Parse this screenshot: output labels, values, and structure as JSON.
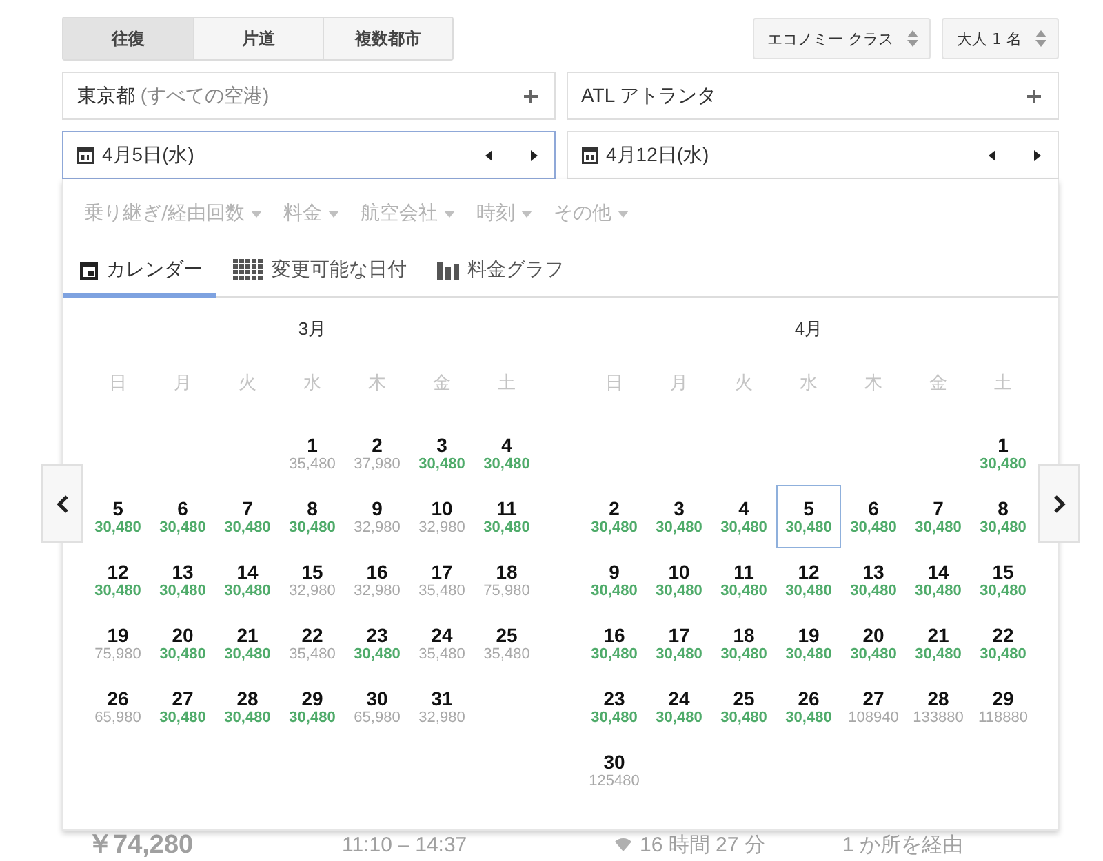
{
  "trip_types": [
    {
      "label": "往復",
      "selected": true
    },
    {
      "label": "片道",
      "selected": false
    },
    {
      "label": "複数都市",
      "selected": false
    }
  ],
  "cabin_select": {
    "value": "エコノミー クラス"
  },
  "passengers_select": {
    "value": "大人 1 名"
  },
  "origin": {
    "value": "東京都",
    "note": "(すべての空港)"
  },
  "destination": {
    "value": "ATL アトランタ"
  },
  "depart_date": {
    "value": "4月5日(水)",
    "focused": true
  },
  "return_date": {
    "value": "4月12日(水)",
    "focused": false
  },
  "filters": [
    "乗り継ぎ/経由回数",
    "料金",
    "航空会社",
    "時刻",
    "その他"
  ],
  "view_tabs": [
    {
      "label": "カレンダー",
      "kind": "calendar",
      "selected": true
    },
    {
      "label": "変更可能な日付",
      "kind": "grid",
      "selected": false
    },
    {
      "label": "料金グラフ",
      "kind": "bars",
      "selected": false
    }
  ],
  "months": [
    {
      "title": "3月",
      "weekdays": [
        "日",
        "月",
        "火",
        "水",
        "木",
        "金",
        "土"
      ],
      "weeks": [
        {
          "starts_mid_week": true,
          "days": [
            {
              "day": "1",
              "price": "35,480",
              "cheap": false,
              "selected": false
            },
            {
              "day": "2",
              "price": "37,980",
              "cheap": false,
              "selected": false
            },
            {
              "day": "3",
              "price": "30,480",
              "cheap": true,
              "selected": false
            },
            {
              "day": "4",
              "price": "30,480",
              "cheap": true,
              "selected": false
            }
          ]
        },
        {
          "starts_mid_week": false,
          "days": [
            {
              "day": "5",
              "price": "30,480",
              "cheap": true,
              "selected": false
            },
            {
              "day": "6",
              "price": "30,480",
              "cheap": true,
              "selected": false
            },
            {
              "day": "7",
              "price": "30,480",
              "cheap": true,
              "selected": false
            },
            {
              "day": "8",
              "price": "30,480",
              "cheap": true,
              "selected": false
            },
            {
              "day": "9",
              "price": "32,980",
              "cheap": false,
              "selected": false
            },
            {
              "day": "10",
              "price": "32,980",
              "cheap": false,
              "selected": false
            },
            {
              "day": "11",
              "price": "30,480",
              "cheap": true,
              "selected": false
            }
          ]
        },
        {
          "starts_mid_week": false,
          "days": [
            {
              "day": "12",
              "price": "30,480",
              "cheap": true,
              "selected": false
            },
            {
              "day": "13",
              "price": "30,480",
              "cheap": true,
              "selected": false
            },
            {
              "day": "14",
              "price": "30,480",
              "cheap": true,
              "selected": false
            },
            {
              "day": "15",
              "price": "32,980",
              "cheap": false,
              "selected": false
            },
            {
              "day": "16",
              "price": "32,980",
              "cheap": false,
              "selected": false
            },
            {
              "day": "17",
              "price": "35,480",
              "cheap": false,
              "selected": false
            },
            {
              "day": "18",
              "price": "75,980",
              "cheap": false,
              "selected": false
            }
          ]
        },
        {
          "starts_mid_week": false,
          "days": [
            {
              "day": "19",
              "price": "75,980",
              "cheap": false,
              "selected": false
            },
            {
              "day": "20",
              "price": "30,480",
              "cheap": true,
              "selected": false
            },
            {
              "day": "21",
              "price": "30,480",
              "cheap": true,
              "selected": false
            },
            {
              "day": "22",
              "price": "35,480",
              "cheap": false,
              "selected": false
            },
            {
              "day": "23",
              "price": "30,480",
              "cheap": true,
              "selected": false
            },
            {
              "day": "24",
              "price": "35,480",
              "cheap": false,
              "selected": false
            },
            {
              "day": "25",
              "price": "35,480",
              "cheap": false,
              "selected": false
            }
          ]
        },
        {
          "starts_mid_week": false,
          "days": [
            {
              "day": "26",
              "price": "65,980",
              "cheap": false,
              "selected": false
            },
            {
              "day": "27",
              "price": "30,480",
              "cheap": true,
              "selected": false
            },
            {
              "day": "28",
              "price": "30,480",
              "cheap": true,
              "selected": false
            },
            {
              "day": "29",
              "price": "30,480",
              "cheap": true,
              "selected": false
            },
            {
              "day": "30",
              "price": "65,980",
              "cheap": false,
              "selected": false
            },
            {
              "day": "31",
              "price": "32,980",
              "cheap": false,
              "selected": false
            }
          ]
        }
      ]
    },
    {
      "title": "4月",
      "weekdays": [
        "日",
        "月",
        "火",
        "水",
        "木",
        "金",
        "土"
      ],
      "weeks": [
        {
          "starts_mid_week": true,
          "days": [
            {
              "day": "1",
              "price": "30,480",
              "cheap": true,
              "selected": false
            }
          ]
        },
        {
          "starts_mid_week": false,
          "days": [
            {
              "day": "2",
              "price": "30,480",
              "cheap": true,
              "selected": false
            },
            {
              "day": "3",
              "price": "30,480",
              "cheap": true,
              "selected": false
            },
            {
              "day": "4",
              "price": "30,480",
              "cheap": true,
              "selected": false
            },
            {
              "day": "5",
              "price": "30,480",
              "cheap": true,
              "selected": true
            },
            {
              "day": "6",
              "price": "30,480",
              "cheap": true,
              "selected": false
            },
            {
              "day": "7",
              "price": "30,480",
              "cheap": true,
              "selected": false
            },
            {
              "day": "8",
              "price": "30,480",
              "cheap": true,
              "selected": false
            }
          ]
        },
        {
          "starts_mid_week": false,
          "days": [
            {
              "day": "9",
              "price": "30,480",
              "cheap": true,
              "selected": false
            },
            {
              "day": "10",
              "price": "30,480",
              "cheap": true,
              "selected": false
            },
            {
              "day": "11",
              "price": "30,480",
              "cheap": true,
              "selected": false
            },
            {
              "day": "12",
              "price": "30,480",
              "cheap": true,
              "selected": false
            },
            {
              "day": "13",
              "price": "30,480",
              "cheap": true,
              "selected": false
            },
            {
              "day": "14",
              "price": "30,480",
              "cheap": true,
              "selected": false
            },
            {
              "day": "15",
              "price": "30,480",
              "cheap": true,
              "selected": false
            }
          ]
        },
        {
          "starts_mid_week": false,
          "days": [
            {
              "day": "16",
              "price": "30,480",
              "cheap": true,
              "selected": false
            },
            {
              "day": "17",
              "price": "30,480",
              "cheap": true,
              "selected": false
            },
            {
              "day": "18",
              "price": "30,480",
              "cheap": true,
              "selected": false
            },
            {
              "day": "19",
              "price": "30,480",
              "cheap": true,
              "selected": false
            },
            {
              "day": "20",
              "price": "30,480",
              "cheap": true,
              "selected": false
            },
            {
              "day": "21",
              "price": "30,480",
              "cheap": true,
              "selected": false
            },
            {
              "day": "22",
              "price": "30,480",
              "cheap": true,
              "selected": false
            }
          ]
        },
        {
          "starts_mid_week": false,
          "days": [
            {
              "day": "23",
              "price": "30,480",
              "cheap": true,
              "selected": false
            },
            {
              "day": "24",
              "price": "30,480",
              "cheap": true,
              "selected": false
            },
            {
              "day": "25",
              "price": "30,480",
              "cheap": true,
              "selected": false
            },
            {
              "day": "26",
              "price": "30,480",
              "cheap": true,
              "selected": false
            },
            {
              "day": "27",
              "price": "108940",
              "cheap": false,
              "selected": false
            },
            {
              "day": "28",
              "price": "133880",
              "cheap": false,
              "selected": false
            },
            {
              "day": "29",
              "price": "118880",
              "cheap": false,
              "selected": false
            }
          ]
        },
        {
          "starts_mid_week": false,
          "days": [
            {
              "day": "30",
              "price": "125480",
              "cheap": false,
              "selected": false
            }
          ]
        }
      ]
    }
  ],
  "results_behind": {
    "price": "￥74,280",
    "times": "11:10 – 14:37",
    "duration": "16 時間 27 分",
    "stops": "1 か所を経由"
  }
}
